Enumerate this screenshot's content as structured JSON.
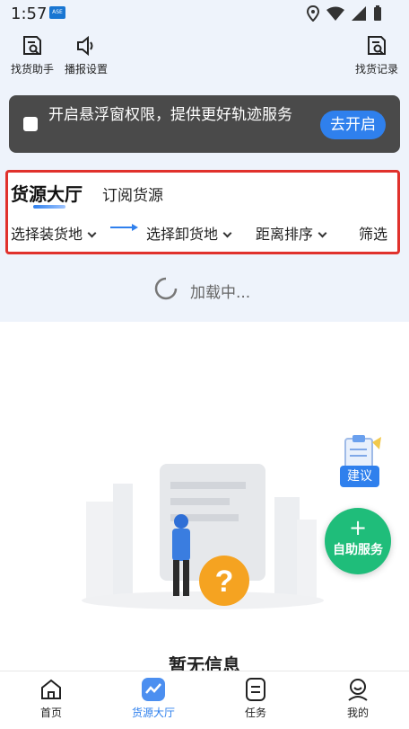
{
  "status_bar": {
    "time": "1:57",
    "badge": "ASE"
  },
  "toolbar": {
    "left": [
      {
        "label": "找货助手",
        "icon": "search-doc-icon"
      },
      {
        "label": "播报设置",
        "icon": "speaker-icon"
      }
    ],
    "right": {
      "label": "找货记录",
      "icon": "search-doc-icon"
    }
  },
  "notice": {
    "text": "开启悬浮窗权限，提供更好轨迹服务",
    "button": "去开启"
  },
  "hall": {
    "tabs": {
      "active": "货源大厅",
      "other": "订阅货源"
    },
    "filters": {
      "load": "选择装货地",
      "unload": "选择卸货地",
      "sort": "距离排序",
      "filter": "筛选"
    }
  },
  "loading": {
    "text": "加载中..."
  },
  "empty": {
    "text": "暂无信息"
  },
  "floating": {
    "suggest": "建议",
    "self_service": "自助服务"
  },
  "bottom_nav": [
    {
      "label": "首页",
      "icon": "home-icon",
      "active": false
    },
    {
      "label": "货源大厅",
      "icon": "trend-icon",
      "active": true
    },
    {
      "label": "任务",
      "icon": "task-icon",
      "active": false
    },
    {
      "label": "我的",
      "icon": "profile-icon",
      "active": false
    }
  ],
  "colors": {
    "accent": "#2f80ed",
    "notice_bg": "#4a4a4a",
    "highlight_border": "#e0312c",
    "service_green": "#1fbd7a",
    "page_bg": "#eef3fb"
  }
}
